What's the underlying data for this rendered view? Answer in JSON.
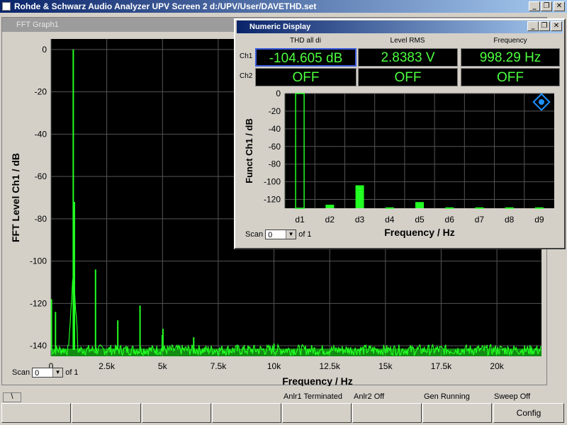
{
  "app": {
    "title": "Rohde & Schwarz Audio Analyzer UPV Screen 2  d:/UPV/User/DAVETHD.set",
    "window_buttons": {
      "minimize": "_",
      "restore": "❐",
      "close": "✕"
    }
  },
  "fft_graph": {
    "panel_title": "FFT Graph1",
    "scan_label": "Scan",
    "scan_value": "0",
    "scan_of": "of 1",
    "chart_data": {
      "type": "line",
      "xlabel": "Frequency / Hz",
      "ylabel": "FFT Level Ch1 / dB",
      "xlim": [
        0,
        22000
      ],
      "ylim": [
        -145,
        5
      ],
      "x_ticks": [
        "0",
        "2.5k",
        "5k",
        "7.5k",
        "10k",
        "12.5k",
        "15k",
        "17.5k",
        "20k"
      ],
      "x_tick_values": [
        0,
        2500,
        5000,
        7500,
        10000,
        12500,
        15000,
        17500,
        20000
      ],
      "y_ticks": [
        "0",
        "-20",
        "-40",
        "-60",
        "-80",
        "-100",
        "-120",
        "-140"
      ],
      "y_tick_values": [
        0,
        -20,
        -40,
        -60,
        -80,
        -100,
        -120,
        -140
      ],
      "grid": true,
      "noise_floor": -143,
      "peaks": [
        {
          "x": 20,
          "y": -118
        },
        {
          "x": 200,
          "y": -124
        },
        {
          "x": 998,
          "y": 0
        },
        {
          "x": 1050,
          "y": -72
        },
        {
          "x": 1996,
          "y": -104
        },
        {
          "x": 2994,
          "y": -128
        },
        {
          "x": 3992,
          "y": -121
        },
        {
          "x": 4990,
          "y": -135
        },
        {
          "x": 5020,
          "y": -132
        },
        {
          "x": 6400,
          "y": -136
        },
        {
          "x": 10000,
          "y": -139
        }
      ],
      "series_color": "#22ff22"
    }
  },
  "numeric_display": {
    "panel_title": "Numeric Display",
    "columns": [
      "THD all di",
      "Level RMS",
      "Frequency"
    ],
    "rows": [
      {
        "label": "Ch1",
        "values": [
          "-104.605 dB",
          "2.8383 V",
          "998.29 Hz"
        ]
      },
      {
        "label": "Ch2",
        "values": [
          "OFF",
          "OFF",
          "OFF"
        ]
      }
    ]
  },
  "thd_graph": {
    "scan_label": "Scan",
    "scan_value": "0",
    "scan_of": "of 1",
    "chart_data": {
      "type": "bar",
      "categories": [
        "d1",
        "d2",
        "d3",
        "d4",
        "d5",
        "d6",
        "d7",
        "d8",
        "d9"
      ],
      "values": [
        0,
        -126,
        -104,
        -129,
        -123,
        -129,
        -129,
        -129,
        -129
      ],
      "xlabel": "Frequency / Hz",
      "ylabel": "Funct Ch1 / dB",
      "ylim": [
        -130,
        0
      ],
      "y_ticks": [
        "0",
        "-20",
        "-40",
        "-60",
        "-80",
        "-100",
        "-120"
      ],
      "y_tick_values": [
        0,
        -20,
        -40,
        -60,
        -80,
        -100,
        -120
      ],
      "grid": true,
      "bar_color": "#22ff22"
    }
  },
  "status": {
    "items": [
      "Anlr1 Terminated",
      "Anlr2 Off",
      "Gen Running",
      "Sweep Off"
    ],
    "left_tab": "\\",
    "buttons": [
      "",
      "",
      "",
      "",
      "",
      "",
      "",
      "Config"
    ]
  }
}
